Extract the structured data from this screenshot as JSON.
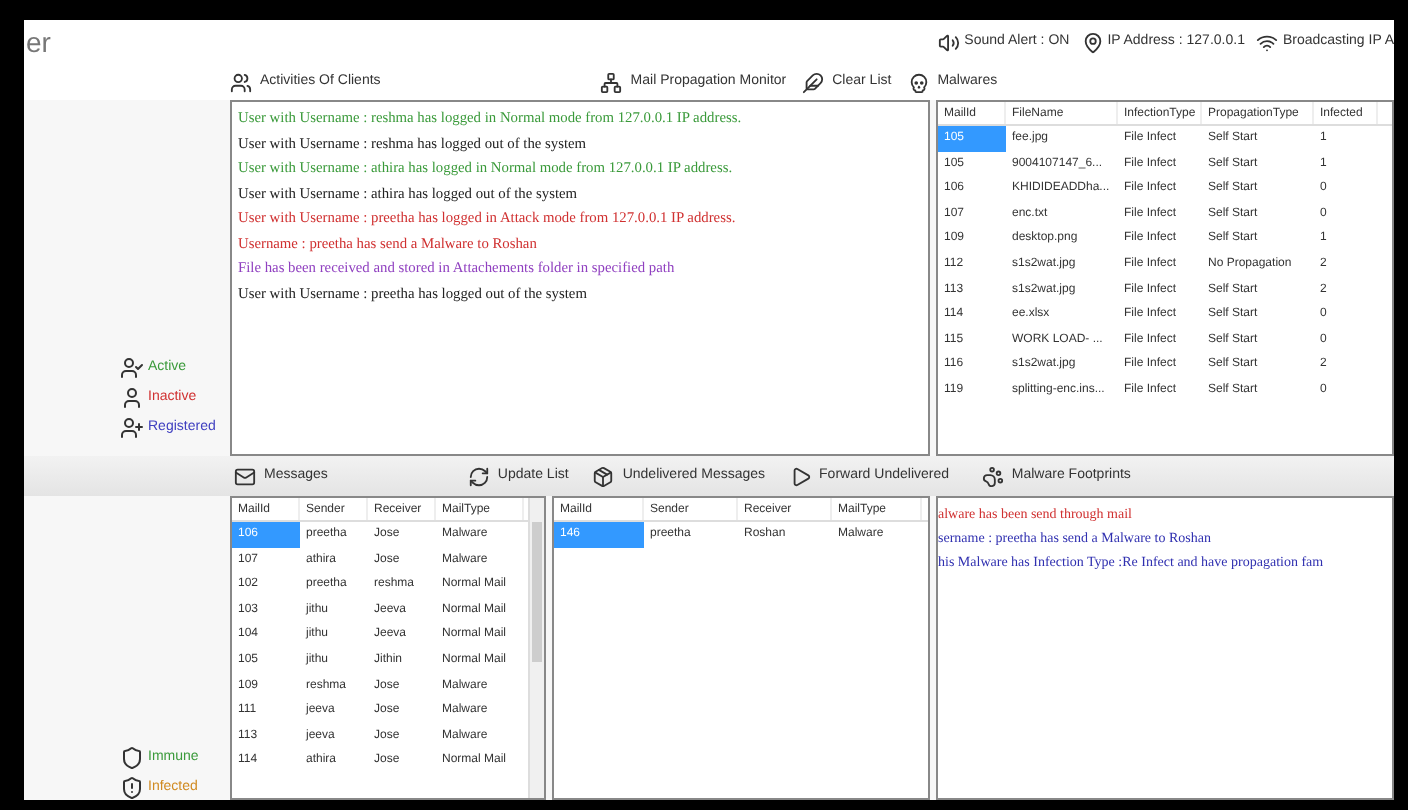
{
  "window": {
    "title": "er"
  },
  "status": [
    {
      "kind": "sound",
      "label": "Sound Alert : ON"
    },
    {
      "kind": "ip",
      "label": "IP Address : 127.0.0.1"
    },
    {
      "kind": "broadcast",
      "label": "Broadcasting IP A"
    }
  ],
  "toolbar": [
    {
      "kind": "clients",
      "label": "Activities Of Clients"
    },
    {
      "kind": "propagation",
      "label": "Mail Propagation Monitor"
    },
    {
      "kind": "clear",
      "label": "Clear List"
    },
    {
      "kind": "malwares",
      "label": "Malwares"
    }
  ],
  "legend_top": [
    {
      "kind": "active",
      "label": "Active",
      "color": "#3a9a3a"
    },
    {
      "kind": "inactive",
      "label": "Inactive",
      "color": "#d03030"
    },
    {
      "kind": "registered",
      "label": "Registered",
      "color": "#4040c0"
    }
  ],
  "log": [
    {
      "kind": "login",
      "text": "User with Username : reshma has logged in Normal mode from 127.0.0.1  IP address."
    },
    {
      "kind": "logout",
      "text": "User with Username : reshma has logged out of the system"
    },
    {
      "kind": "login",
      "text": "User with Username : athira has logged in Normal mode from 127.0.0.1  IP address."
    },
    {
      "kind": "logout",
      "text": "User with Username : athira has logged out of the system"
    },
    {
      "kind": "attack",
      "text": "User with Username : preetha has logged in Attack mode from 127.0.0.1 IP address."
    },
    {
      "kind": "attack",
      "text": "Username : preetha has send a Malware to Roshan"
    },
    {
      "kind": "file",
      "text": "File has been received and stored in Attachements folder in specified path"
    },
    {
      "kind": "logout",
      "text": "User with Username : preetha has logged out of the system"
    }
  ],
  "malware_table": {
    "columns": [
      "MailId",
      "FileName",
      "InfectionType",
      "PropagationType",
      "Infected"
    ],
    "rows": [
      {
        "selected": true,
        "cells": [
          "105",
          "fee.jpg",
          "File Infect",
          "Self Start",
          "1"
        ]
      },
      {
        "selected": false,
        "cells": [
          "105",
          "9004107147_6...",
          "File Infect",
          "Self Start",
          "1"
        ]
      },
      {
        "selected": false,
        "cells": [
          "106",
          "KHIDIDEADDha...",
          "File Infect",
          "Self Start",
          "0"
        ]
      },
      {
        "selected": false,
        "cells": [
          "107",
          "enc.txt",
          "File Infect",
          "Self Start",
          "0"
        ]
      },
      {
        "selected": false,
        "cells": [
          "109",
          "desktop.png",
          "File Infect",
          "Self Start",
          "1"
        ]
      },
      {
        "selected": false,
        "cells": [
          "112",
          "s1s2wat.jpg",
          "File Infect",
          "No Propagation",
          "2"
        ]
      },
      {
        "selected": false,
        "cells": [
          "113",
          "s1s2wat.jpg",
          "File Infect",
          "Self Start",
          "2"
        ]
      },
      {
        "selected": false,
        "cells": [
          "114",
          "ee.xlsx",
          "File Infect",
          "Self Start",
          "0"
        ]
      },
      {
        "selected": false,
        "cells": [
          "115",
          "WORK LOAD- ...",
          "File Infect",
          "Self Start",
          "0"
        ]
      },
      {
        "selected": false,
        "cells": [
          "116",
          "s1s2wat.jpg",
          "File Infect",
          "Self Start",
          "2"
        ]
      },
      {
        "selected": false,
        "cells": [
          "119",
          "splitting-enc.ins...",
          "File Infect",
          "Self Start",
          "0"
        ]
      }
    ]
  },
  "toolbar2": [
    {
      "kind": "messages",
      "label": "Messages"
    },
    {
      "kind": "update",
      "label": "Update List"
    },
    {
      "kind": "undelivered",
      "label": "Undelivered Messages"
    },
    {
      "kind": "forward",
      "label": "Forward Undelivered"
    },
    {
      "kind": "footprints",
      "label": "Malware Footprints"
    }
  ],
  "messages_table": {
    "columns": [
      "MailId",
      "Sender",
      "Receiver",
      "MailType"
    ],
    "rows": [
      {
        "selected": true,
        "cells": [
          "106",
          "preetha",
          "Jose",
          "Malware"
        ]
      },
      {
        "selected": false,
        "cells": [
          "107",
          "athira",
          "Jose",
          "Malware"
        ]
      },
      {
        "selected": false,
        "cells": [
          "102",
          "preetha",
          "reshma",
          "Normal Mail"
        ]
      },
      {
        "selected": false,
        "cells": [
          "103",
          "jithu",
          "Jeeva",
          "Normal Mail"
        ]
      },
      {
        "selected": false,
        "cells": [
          "104",
          "jithu",
          "Jeeva",
          "Normal Mail"
        ]
      },
      {
        "selected": false,
        "cells": [
          "105",
          "jithu",
          "Jithin",
          "Normal Mail"
        ]
      },
      {
        "selected": false,
        "cells": [
          "109",
          "reshma",
          "Jose",
          "Malware"
        ]
      },
      {
        "selected": false,
        "cells": [
          "111",
          "jeeva",
          "Jose",
          "Malware"
        ]
      },
      {
        "selected": false,
        "cells": [
          "113",
          "jeeva",
          "Jose",
          "Malware"
        ]
      },
      {
        "selected": false,
        "cells": [
          "114",
          "athira",
          "Jose",
          "Normal Mail"
        ]
      }
    ]
  },
  "undelivered_table": {
    "columns": [
      "MailId",
      "Sender",
      "Receiver",
      "MailType"
    ],
    "rows": [
      {
        "selected": true,
        "cells": [
          "146",
          "preetha",
          "Roshan",
          "Malware"
        ]
      }
    ]
  },
  "footprints": [
    {
      "kind": "alert",
      "text": "alware has been send through mail"
    },
    {
      "kind": "info",
      "text": "sername : preetha has send a Malware to Roshan"
    },
    {
      "kind": "info",
      "text": "his Malware has Infection Type :Re Infect and have propagation fam"
    }
  ],
  "legend_bottom": [
    {
      "kind": "immune",
      "label": "Immune",
      "color": "#3a9a3a"
    },
    {
      "kind": "infected",
      "label": "Infected",
      "color": "#d08a20"
    }
  ]
}
